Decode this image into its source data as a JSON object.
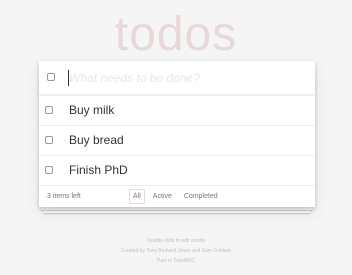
{
  "header": {
    "title": "todos",
    "new_todo_placeholder": "What needs to be done?"
  },
  "todos": [
    {
      "label": "Buy milk",
      "completed": false
    },
    {
      "label": "Buy bread",
      "completed": false
    },
    {
      "label": "Finish PhD",
      "completed": false
    }
  ],
  "footer": {
    "count_text": "3 items left",
    "filters": [
      {
        "label": "All",
        "selected": true
      },
      {
        "label": "Active",
        "selected": false
      },
      {
        "label": "Completed",
        "selected": false
      }
    ]
  },
  "info": {
    "line1": "Double-click to edit a todo",
    "line2": "Created by Tony Bedwell Jones and Sam Goldwin",
    "line3": "Part of TodoMVC"
  },
  "colors": {
    "title": "#af2f2f",
    "background": "#f5f5f5"
  },
  "icons": {
    "toggle_all": "checkbox-icon",
    "todo_toggle": "checkbox-icon"
  }
}
